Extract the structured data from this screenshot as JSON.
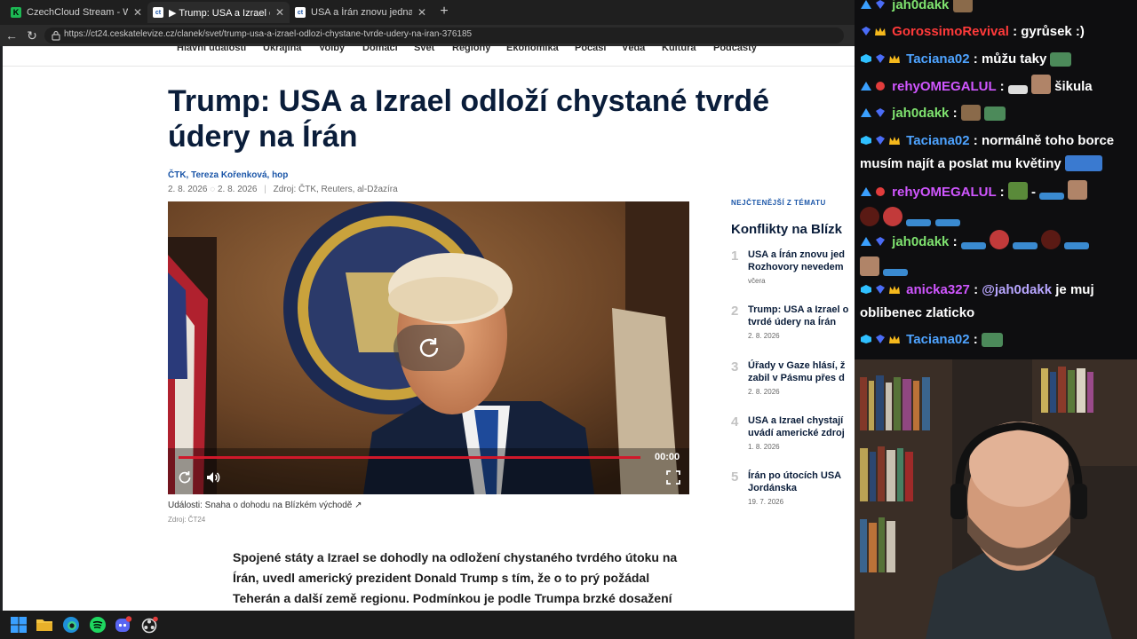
{
  "browser": {
    "tabs": [
      {
        "label": "CzechCloud Stream - Watch Live o",
        "active": false,
        "favicon": "K"
      },
      {
        "label": "▶ Trump: USA a Izrael odloží chyst",
        "active": true,
        "favicon": "ct"
      },
      {
        "label": "USA a Írán znovu jednají, tvrdí Tru",
        "active": false,
        "favicon": "ct"
      }
    ],
    "url": "https://ct24.ceskatelevize.cz/clanek/svet/trump-usa-a-izrael-odlozi-chystane-tvrde-udery-na-iran-376185"
  },
  "page": {
    "nav": [
      "Hlavní události",
      "Ukrajina",
      "Volby",
      "Domácí",
      "Svět",
      "Regiony",
      "Ekonomika",
      "Počasí",
      "Věda",
      "Kultura",
      "Podcasty"
    ],
    "headline": "Trump: USA a Izrael odloží chystané tvrdé údery na Írán",
    "authors": "ČTK, Tereza Kořenková, hop",
    "date": "2. 8. 2026",
    "updated": "2. 8. 2026",
    "source_line": "Zdroj: ČTK, Reuters, al-Džazíra",
    "video": {
      "timecode": "00:00",
      "caption": "Události: Snaha o dohodu na Blízkém východě",
      "source": "Zdroj: ČT24"
    },
    "body": "Spojené státy a Izrael se dohodly na odložení chystaného tvrdého útoku na Írán, uvedl americký prezident Donald Trump s tím, že o to prý požádal Teherán a další země regionu. Podmínkou je podle Trumpa brzké dosažení dohody, která umožní",
    "sidebar": {
      "label": "NEJČTENĚJŠÍ Z TÉMATU",
      "title": "Konflikty na Blízk",
      "items": [
        {
          "num": "1",
          "title": "USA a Írán znovu jed Rozhovory nevedem",
          "date": "včera"
        },
        {
          "num": "2",
          "title": "Trump: USA a Izrael o tvrdé údery na Írán",
          "date": "2. 8. 2026"
        },
        {
          "num": "3",
          "title": "Úřady v Gaze hlásí, ž zabil v Pásmu přes d",
          "date": "2. 8. 2026"
        },
        {
          "num": "4",
          "title": "USA a Izrael chystají uvádí americké zdroj",
          "date": "1. 8. 2026"
        },
        {
          "num": "5",
          "title": "Írán po útocích USA Jordánska",
          "date": "19. 7. 2026"
        }
      ]
    }
  },
  "chat": {
    "messages": [
      {
        "user": "jah0dakk",
        "color": "#7fe36f",
        "parts": []
      },
      {
        "user": "GorossimoRevival",
        "color": "#ff3a3a",
        "parts": [
          ": gyrůsek :)"
        ]
      },
      {
        "user": "Taciana02",
        "color": "#4ea3ff",
        "parts": [
          ": můžu taky"
        ]
      },
      {
        "user": "rehyOMEGALUL",
        "color": "#d056ff",
        "parts": [
          ":",
          "šikula"
        ]
      },
      {
        "user": "jah0dakk",
        "color": "#7fe36f",
        "parts": [
          ":"
        ]
      },
      {
        "user": "Taciana02",
        "color": "#4ea3ff",
        "parts": [
          ": normálně toho borce",
          "musím najít a poslat mu květiny"
        ]
      },
      {
        "user": "rehyOMEGALUL",
        "color": "#d056ff",
        "parts": [
          ":",
          "-"
        ]
      },
      {
        "user": "jah0dakk",
        "color": "#7fe36f",
        "parts": [
          ":"
        ]
      },
      {
        "user": "anicka327",
        "color": "#d056ff",
        "parts": [
          ":",
          "@jah0dakk",
          "je muj",
          "oblibenec zlaticko"
        ]
      },
      {
        "user": "Taciana02",
        "color": "#4ea3ff",
        "parts": [
          ":"
        ]
      }
    ]
  }
}
